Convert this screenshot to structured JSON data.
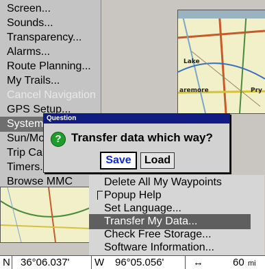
{
  "main_menu": {
    "items": [
      {
        "label": "Screen..."
      },
      {
        "label": "Sounds..."
      },
      {
        "label": "Transparency..."
      },
      {
        "label": "Alarms..."
      },
      {
        "label": "Route Planning..."
      },
      {
        "label": "My Trails..."
      },
      {
        "label": "Cancel Navigation"
      },
      {
        "label": "GPS Setup..."
      },
      {
        "label": "System Setup..."
      },
      {
        "label": "Sun/Moon..."
      },
      {
        "label": "Trip Calculator..."
      },
      {
        "label": "Timers..."
      },
      {
        "label": "Browse MMC"
      }
    ]
  },
  "sub_menu": {
    "items": [
      {
        "label": "Delete All My Waypoints"
      },
      {
        "label": "Popup Help"
      },
      {
        "label": "Set Language..."
      },
      {
        "label": "Transfer My Data..."
      },
      {
        "label": "Check Free Storage..."
      },
      {
        "label": "Software Information..."
      }
    ]
  },
  "dialog": {
    "title": "Question",
    "message": "Transfer data which way?",
    "save_label": "Save",
    "load_label": "Load",
    "icon": "question-icon"
  },
  "map": {
    "labels": [
      "Lake",
      "aremore",
      "Pry"
    ]
  },
  "status_bar": {
    "lat_hemi": "N",
    "lat": "36°06.037'",
    "lon_hemi": "W",
    "lon": "96°05.056'",
    "distance_icon": "↔",
    "distance": "60",
    "unit": "mi"
  },
  "colors": {
    "dialog_title_bar": "#101c82",
    "highlight": "#6f6f6f",
    "save_text": "#0b2bd9",
    "question_icon": "#1f9d2a"
  }
}
